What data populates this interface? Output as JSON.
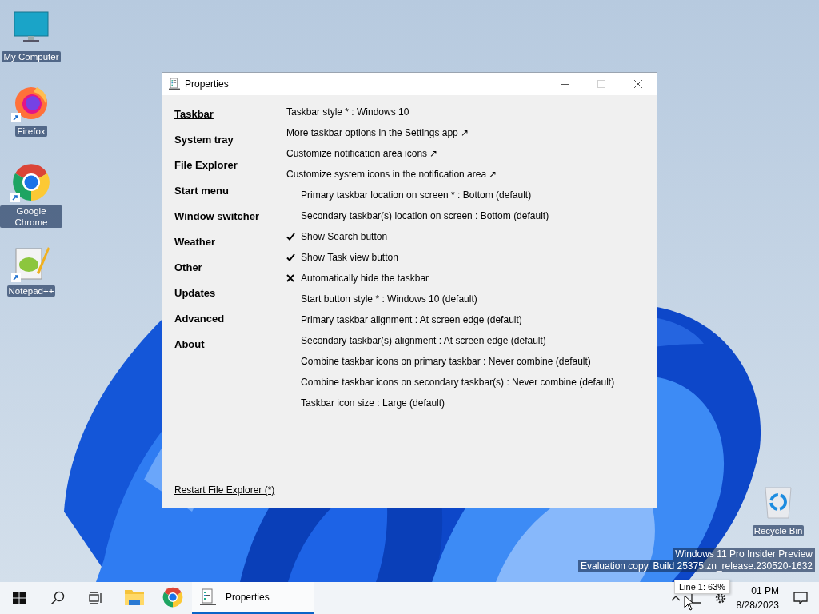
{
  "desktop_icons": [
    {
      "kind": "computer",
      "label": "My Computer",
      "shortcut": false
    },
    {
      "kind": "firefox",
      "label": "Firefox",
      "shortcut": true
    },
    {
      "kind": "chrome",
      "label": "Google Chrome",
      "shortcut": true
    },
    {
      "kind": "notepad",
      "label": "Notepad++",
      "shortcut": true
    },
    {
      "kind": "recycle-bin",
      "label": "Recycle Bin",
      "shortcut": false
    }
  ],
  "window": {
    "title": "Properties",
    "title_buttons": [
      {
        "kind": "minimize",
        "disabled": false
      },
      {
        "kind": "maximize",
        "disabled": true
      },
      {
        "kind": "close",
        "disabled": false
      }
    ],
    "sidebar": [
      {
        "label": "Taskbar",
        "selected": true
      },
      {
        "label": "System tray",
        "selected": false
      },
      {
        "label": "File Explorer",
        "selected": false
      },
      {
        "label": "Start menu",
        "selected": false
      },
      {
        "label": "Window switcher",
        "selected": false
      },
      {
        "label": "Weather",
        "selected": false
      },
      {
        "label": "Other",
        "selected": false
      },
      {
        "label": "Updates",
        "selected": false
      },
      {
        "label": "Advanced",
        "selected": false
      },
      {
        "label": "About",
        "selected": false
      }
    ],
    "settings": [
      {
        "kind": "main",
        "text": "Taskbar style * : Windows 10"
      },
      {
        "kind": "main",
        "text": "More taskbar options in the Settings app ↗"
      },
      {
        "kind": "main",
        "text": "Customize notification area icons ↗"
      },
      {
        "kind": "main",
        "text": "Customize system icons in the notification area ↗"
      },
      {
        "kind": "option",
        "text": "Primary taskbar location on screen * : Bottom (default)"
      },
      {
        "kind": "option",
        "text": "Secondary taskbar(s) location on screen : Bottom (default)"
      },
      {
        "kind": "toggle",
        "text": "Show Search button",
        "checked": true
      },
      {
        "kind": "toggle",
        "text": "Show Task view button",
        "checked": true
      },
      {
        "kind": "toggle",
        "text": "Automatically hide the taskbar",
        "checked": false
      },
      {
        "kind": "option",
        "text": "Start button style * : Windows 10 (default)"
      },
      {
        "kind": "option",
        "text": "Primary taskbar alignment : At screen edge (default)"
      },
      {
        "kind": "option",
        "text": "Secondary taskbar(s) alignment : At screen edge (default)"
      },
      {
        "kind": "option",
        "text": "Combine taskbar icons on primary taskbar : Never combine (default)"
      },
      {
        "kind": "option",
        "text": "Combine taskbar icons on secondary taskbar(s) : Never combine (default)"
      },
      {
        "kind": "option",
        "text": "Taskbar icon size : Large (default)"
      }
    ],
    "footer_link": "Restart File Explorer (*)"
  },
  "watermark": [
    "Windows 11 Pro Insider Preview",
    "Evaluation copy. Build 25375.zn_release.230520-1632"
  ],
  "taskbar": {
    "apps": [
      {
        "kind": "folder",
        "selected": false
      },
      {
        "kind": "chrome",
        "selected": false
      },
      {
        "kind": "properties",
        "label": "Properties",
        "selected": true
      }
    ],
    "tooltip": "Line 1: 63%",
    "clock": {
      "time": "01 PM",
      "date": "8/28/2023"
    }
  }
}
